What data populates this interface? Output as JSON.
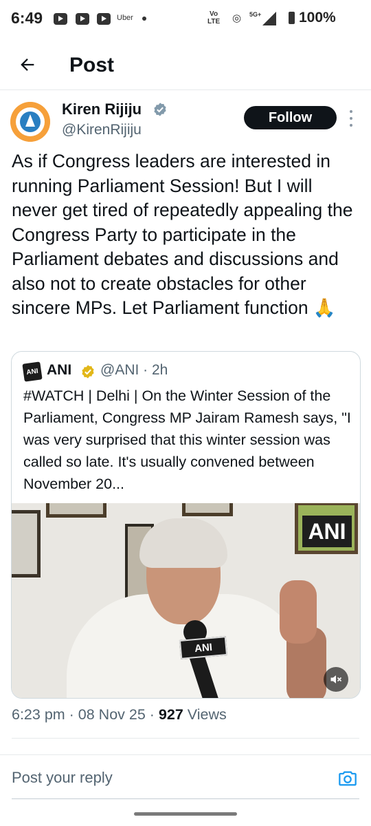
{
  "status_bar": {
    "time": "6:49",
    "notification_icons": [
      "youtube-icon",
      "youtube-icon",
      "youtube-icon"
    ],
    "uber_label": "Uber",
    "volte_label": "Vo\nLTE",
    "network_label": "5G+",
    "battery": "100%"
  },
  "header": {
    "title": "Post",
    "back_icon": "arrow-left-icon"
  },
  "post": {
    "author_name": "Kiren Rijiju",
    "author_handle": "@KirenRijiju",
    "follow_label": "Follow",
    "text": "As if Congress leaders are interested in running Parliament Session! But I will never get tired of repeatedly appealing the Congress Party to participate in the Parliament debates and discussions and also not to create obstacles for other sincere MPs. Let Parliament function 🙏",
    "timestamp": "6:23 pm · 08 Nov 25 · ",
    "views_count": "927",
    "views_label": " Views"
  },
  "quote": {
    "logo_text": "ANI",
    "name": "ANI",
    "handle_time": "@ANI · 2h",
    "text": "#WATCH | Delhi | On the Winter Session of the Parliament, Congress MP Jairam Ramesh says, \"I was very surprised that this winter session was called so late. It's usually convened between November 20...",
    "media_badge": "ANI",
    "mic_label": "ANI"
  },
  "reply": {
    "placeholder": "Post your reply"
  },
  "colors": {
    "text": "#0f1419",
    "secondary": "#536471",
    "verified": "#e2b719",
    "accent": "#1d9bf0"
  }
}
